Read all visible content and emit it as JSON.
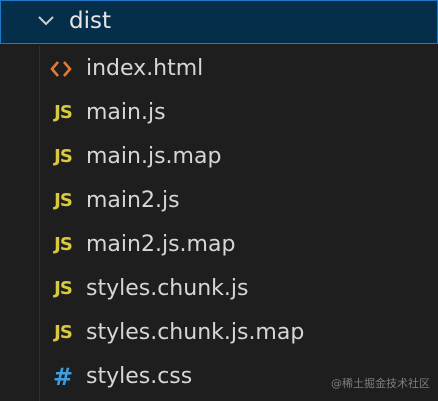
{
  "folder": {
    "name": "dist",
    "icon": "chevron-down-icon"
  },
  "files": [
    {
      "name": "index.html",
      "icon": "html-file-icon",
      "icon_glyph": "",
      "icon_color": "#e37933"
    },
    {
      "name": "main.js",
      "icon": "js-file-icon",
      "icon_glyph": "JS",
      "icon_color": "#d8c93f"
    },
    {
      "name": "main.js.map",
      "icon": "js-file-icon",
      "icon_glyph": "JS",
      "icon_color": "#d8c93f"
    },
    {
      "name": "main2.js",
      "icon": "js-file-icon",
      "icon_glyph": "JS",
      "icon_color": "#d8c93f"
    },
    {
      "name": "main2.js.map",
      "icon": "js-file-icon",
      "icon_glyph": "JS",
      "icon_color": "#d8c93f"
    },
    {
      "name": "styles.chunk.js",
      "icon": "js-file-icon",
      "icon_glyph": "JS",
      "icon_color": "#d8c93f"
    },
    {
      "name": "styles.chunk.js.map",
      "icon": "js-file-icon",
      "icon_glyph": "JS",
      "icon_color": "#d8c93f"
    },
    {
      "name": "styles.css",
      "icon": "css-file-icon",
      "icon_glyph": "#",
      "icon_color": "#3d9ee0"
    }
  ],
  "watermark": "@稀土掘金技术社区",
  "colors": {
    "background": "#1e1e1e",
    "selected_row_bg": "#042e4a",
    "selected_row_border": "#1f79c9",
    "text": "#d6d6d6"
  }
}
